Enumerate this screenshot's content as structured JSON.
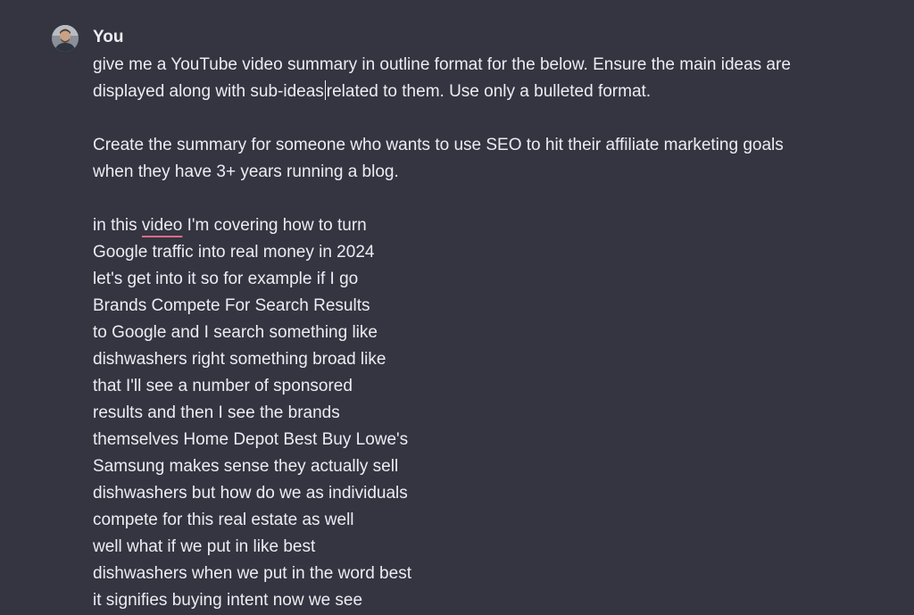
{
  "message": {
    "author": "You",
    "avatar_icon": "user-photo-avatar",
    "para1_before_caret": "give me a YouTube video summary in outline format for the below. Ensure the main ideas are displayed along with sub-ideas",
    "para1_after_caret": "related to them. Use only a bulleted format.",
    "para2": "Create the summary for someone who wants to use SEO to hit their affiliate marketing goals when they have 3+ years running a blog.",
    "transcript_first_prefix": "in this ",
    "transcript_first_flagged": "video",
    "transcript_first_suffix": " I'm covering how to turn",
    "transcript_lines": [
      "Google traffic into real money in 2024",
      "let's get into it so for example if I go",
      "Brands Compete For Search Results",
      "to Google and I search something like",
      "dishwashers right something broad like",
      "that I'll see a number of sponsored",
      "results and then I see the brands",
      "themselves Home Depot Best Buy Lowe's",
      "Samsung makes sense they actually sell",
      "dishwashers but how do we as individuals",
      "compete for this real estate as well",
      "well what if we put in like best",
      "dishwashers when we put in the word best",
      "it signifies buying intent now we see"
    ]
  },
  "colors": {
    "background": "#343541",
    "text": "#ececf1",
    "spellcheck_underline": "#e06c8a"
  }
}
